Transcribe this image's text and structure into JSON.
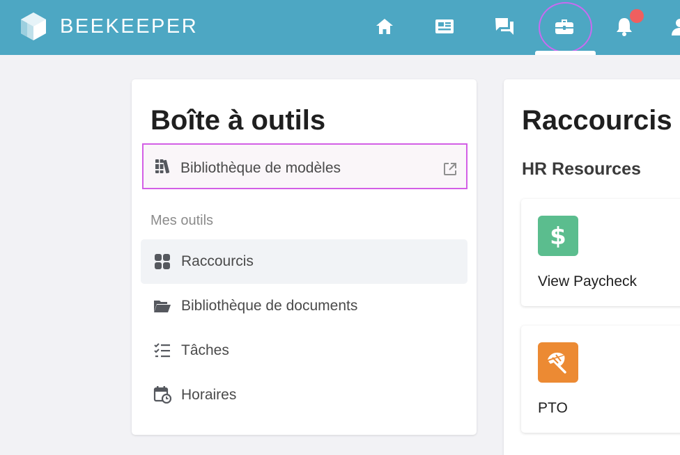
{
  "header": {
    "brand": "BEEKEEPER",
    "bg_color": "#4da7c3",
    "nav": [
      {
        "icon": "home-icon"
      },
      {
        "icon": "newsfeed-icon"
      },
      {
        "icon": "chat-icon"
      },
      {
        "icon": "toolbox-icon",
        "active": true
      },
      {
        "icon": "bell-icon",
        "has_notification": true
      },
      {
        "icon": "user-icon"
      }
    ]
  },
  "toolbox": {
    "title": "Boîte à outils",
    "template_library": "Bibliothèque de modèles",
    "section_label": "Mes outils",
    "items": [
      {
        "label": "Raccourcis",
        "icon": "grid-icon",
        "active": true
      },
      {
        "label": "Bibliothèque de documents",
        "icon": "folder-icon"
      },
      {
        "label": "Tâches",
        "icon": "checklist-icon"
      },
      {
        "label": "Horaires",
        "icon": "calendar-clock-icon"
      }
    ]
  },
  "shortcuts": {
    "title": "Raccourcis",
    "group": "HR Resources",
    "cards": [
      {
        "label": "View Paycheck",
        "icon": "dollar-icon",
        "color": "#5bbd8e"
      },
      {
        "label": "PTO",
        "icon": "umbrella-icon",
        "color": "#ec8a33"
      }
    ]
  },
  "colors": {
    "highlight": "#d35fe6",
    "notification": "#ef5f5f"
  }
}
